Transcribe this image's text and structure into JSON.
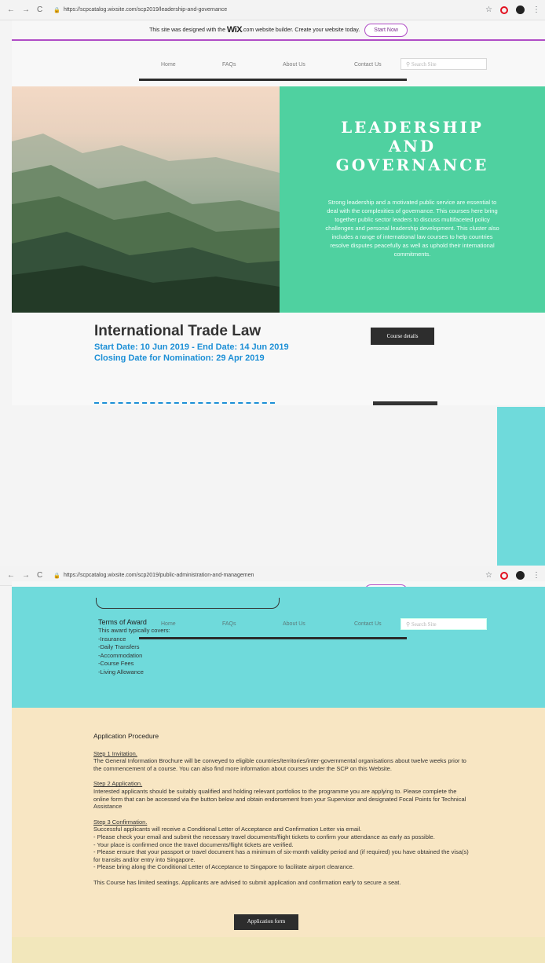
{
  "browser1": {
    "url": "https://scpcatalog.wixsite.com/scp2019/leadership-and-governance"
  },
  "browser2": {
    "url": "https://scpcatalog.wixsite.com/scp2019/public-administration-and-managemen"
  },
  "browser_nav": {
    "back": "←",
    "forward": "→",
    "reload": "C",
    "star": "☆",
    "menu": "⋮"
  },
  "wix_banner": {
    "text_before": "This site was designed with the",
    "brand": "WiX",
    "text_after": ".com website builder. Create your website today.",
    "button": "Start Now"
  },
  "nav": {
    "home": "Home",
    "faqs": "FAQs",
    "about": "About Us",
    "contact": "Contact Us",
    "search_placeholder": "Search Site"
  },
  "hero": {
    "title_lines": [
      "LEADERSHIP",
      "AND",
      "GOVERNANCE"
    ],
    "description": "Strong leadership and a motivated public service are essential to deal with the complexities of governance. This courses here bring together public sector leaders to discuss multifaceted policy challenges and personal leadership development. This cluster also includes a range of international law courses to help countries resolve disputes peacefully as well as uphold their international commitments."
  },
  "course": {
    "title": "International Trade Law",
    "dates": "Start Date: 10 Jun 2019 - End Date: 14 Jun 2019",
    "closing": "Closing Date for Nomination: 29 Apr 2019",
    "button": "Course details"
  },
  "award": {
    "heading": "Terms of Award",
    "intro": "This award typically covers:",
    "items": [
      "-Insurance",
      "-Daily Transfers",
      "-Accommodation",
      "-Course Fees",
      "-Living Allowance"
    ]
  },
  "application": {
    "heading": "Application Procedure",
    "step1_title": "Step 1 Invitation.",
    "step1_body": "The General Information Brochure will be conveyed to eligible countries/territories/inter-governmental organisations about twelve weeks prior to the commencement of a course. You can also find more information about courses under the SCP on this Website.",
    "step2_title": "Step 2 Application.",
    "step2_body": "Interested applicants should be suitably qualified and holding relevant portfolios to the programme you are applying to. Please complete the online form that can be accessed via the button below and obtain endorsement from your Supervisor and designated Focal Points for Technical Assistance",
    "step3_title": "Step 3 Confirmation.",
    "step3_lines": [
      "Successful applicants will receive a Conditional Letter of Acceptance and Confirmation Letter via email.",
      "- Please check your email and submit the necessary travel documents/flight tickets to confirm your attendance as early as possible.",
      "- Your place is confirmed once the travel documents/flight tickets are verified.",
      "- Please ensure that your passport or travel document has a minimum of six-month validity period and (if required) you have obtained the visa(s) for transits and/or entry into Singapore.",
      "- Please bring along the Conditional Letter of Acceptance to Singapore to facilitate airport clearance."
    ],
    "note": "This Course has limited seatings. Applicants are advised to submit application and confirmation early to secure a seat.",
    "button": "Application form"
  },
  "colors": {
    "hero_green": "#4fd1a0",
    "teal": "#6fdadb",
    "cream": "#f8e6c3",
    "link_blue": "#1c8fd6",
    "wix_purple": "#b04cc6"
  }
}
